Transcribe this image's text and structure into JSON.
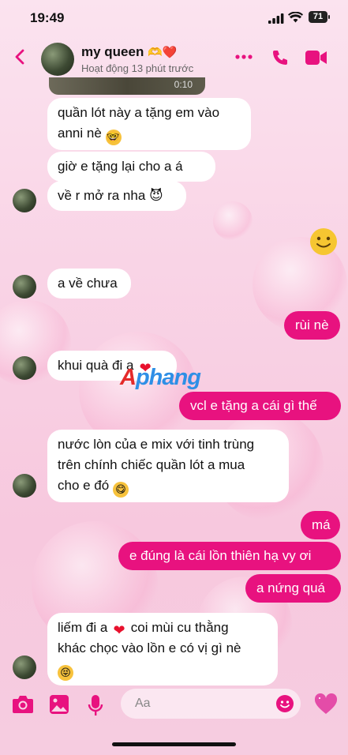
{
  "status_bar": {
    "time": "19:49",
    "battery": "71"
  },
  "header": {
    "name": "my queen",
    "name_emojis": "🫶❤️",
    "activity": "Hoạt động 13 phút trước"
  },
  "video": {
    "duration": "0:10"
  },
  "messages": [
    {
      "from": "them",
      "text": "quần lót này a tặng em vào anni nè 🤓"
    },
    {
      "from": "them",
      "text": "giờ e tặng lại cho a á"
    },
    {
      "from": "them",
      "text": "về r mở ra nha 😈"
    },
    {
      "from": "me",
      "text": "🙂"
    },
    {
      "from": "them",
      "text": "a về chưa"
    },
    {
      "from": "me",
      "text": "rùi nè"
    },
    {
      "from": "them",
      "text": "khui quà đi a ❤️"
    },
    {
      "from": "me",
      "text": "vcl e tặng a cái gì thế"
    },
    {
      "from": "them",
      "text": "nước lòn của e mix với tinh trùng trên chính chiếc quần lót a mua cho e đó 😋"
    },
    {
      "from": "me",
      "text": "má"
    },
    {
      "from": "me",
      "text": "e đúng là cái lồn thiên hạ vy ơi"
    },
    {
      "from": "me",
      "text": "a nứng quá"
    },
    {
      "from": "them",
      "text": "liếm đi a ❤️ coi mùi cu thằng khác chọc vào lồn e có vị gì nè 😝"
    }
  ],
  "lines": {
    "m0a": "quần lót này a tặng em vào",
    "m0b": "anni nè",
    "m8a": "nước lòn của e mix với tinh trùng",
    "m8b": "trên chính chiếc quần lót a mua",
    "m8c": "cho e đó",
    "m12a": "liếm đi a",
    "m12b": "coi mùi cu thằng",
    "m12c": "khác chọc vào lồn e có vị gì nè"
  },
  "watermark": {
    "part1": "A",
    "part2": "phang"
  },
  "composer": {
    "placeholder": "Aa"
  },
  "colors": {
    "accent": "#e8127f",
    "bubble_in": "#ffffff",
    "bg": "#f9d4e6"
  },
  "icons": [
    "back-icon",
    "more-icon",
    "phone-icon",
    "video-icon",
    "camera-icon",
    "image-icon",
    "mic-icon",
    "emoji-icon",
    "heart-icon"
  ]
}
